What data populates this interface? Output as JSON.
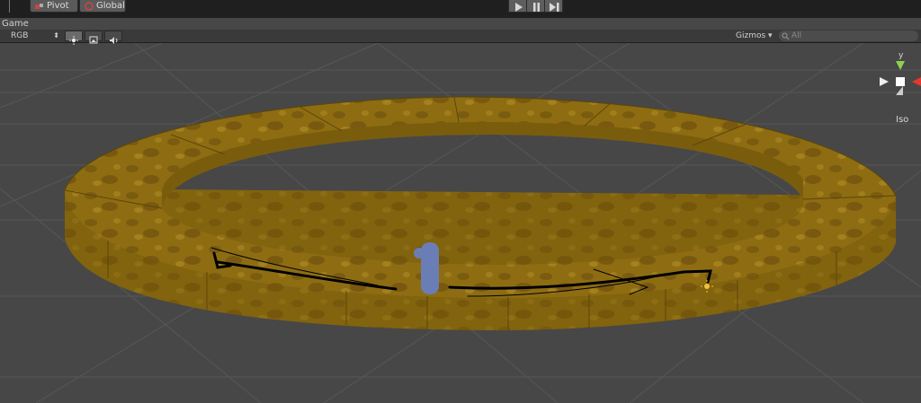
{
  "toolbar": {
    "pivot_label": "Pivot",
    "global_label": "Global",
    "play_icons": [
      "play-icon",
      "pause-icon",
      "step-icon"
    ]
  },
  "game_tab": {
    "label": "Game"
  },
  "scene_bar": {
    "color_mode": "RGB",
    "gizmos_label": "Gizmos",
    "search_placeholder": "All"
  },
  "gizmo": {
    "axis_y_label": "y",
    "projection_label": "Iso",
    "colors": {
      "y": "#8fd14f",
      "x": "#e23a2a",
      "center": "#ffffff"
    }
  },
  "scene": {
    "ring_color": "#8f6f10",
    "capsule_color": "#6a7db4",
    "path_color": "#000000",
    "light_icon": "sun-icon"
  }
}
